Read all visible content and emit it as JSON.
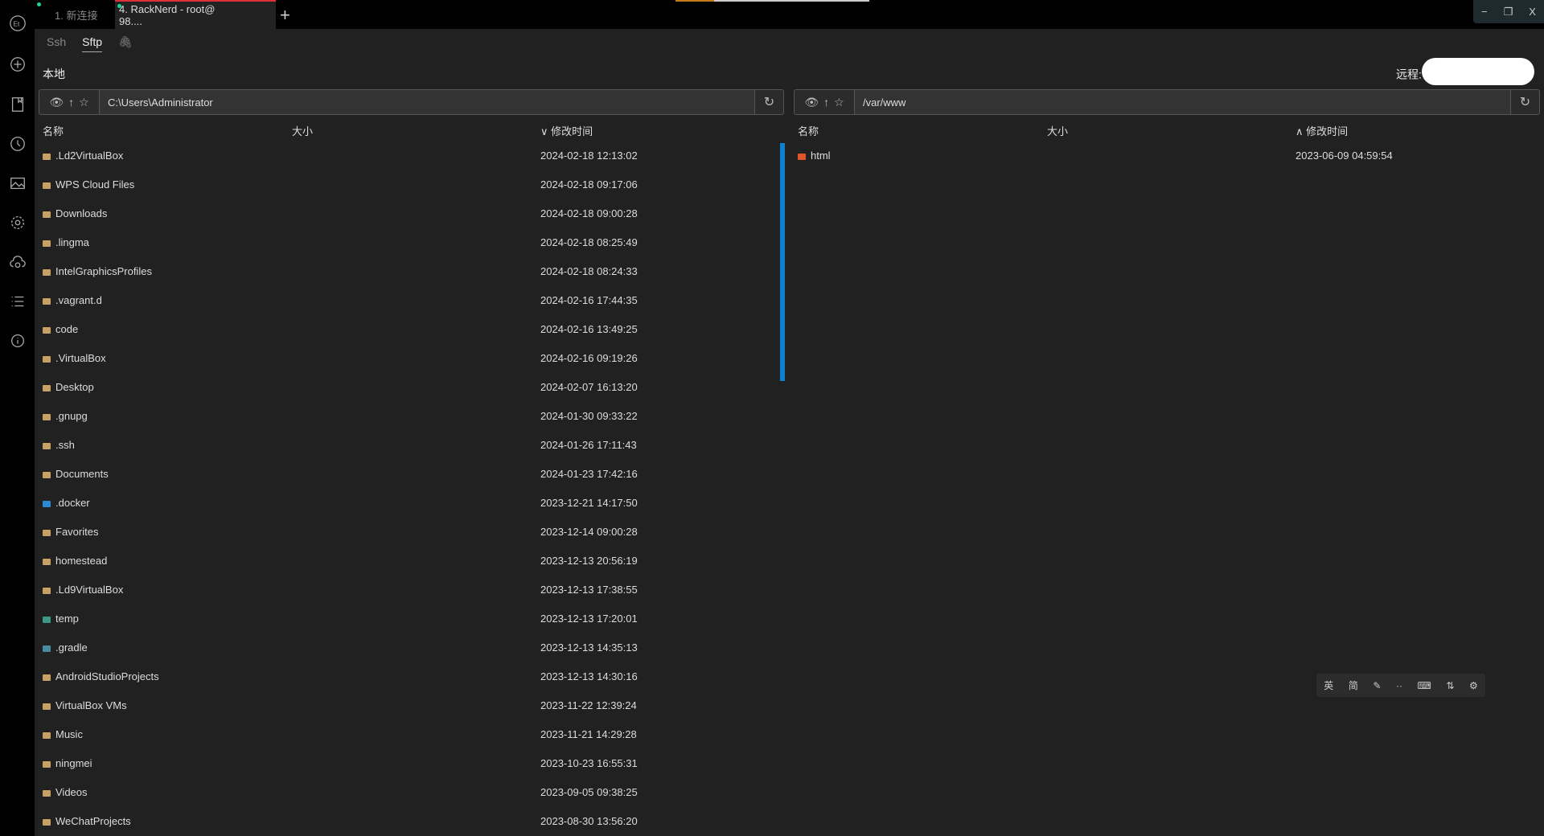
{
  "titlebar": {
    "tabs": [
      {
        "label": "1. 新连接"
      },
      {
        "label": "4. RackNerd - root@    98...."
      }
    ],
    "add_tab": "+",
    "progress_percent": 20,
    "window_controls": {
      "minimize": "−",
      "restore": "❐",
      "close": "X"
    }
  },
  "sidebar": {
    "icons": [
      "logo-icon",
      "add-icon",
      "bookmark-icon",
      "history-icon",
      "image-icon",
      "gear-icon",
      "cloud-sync-icon",
      "list-icon",
      "info-icon"
    ]
  },
  "subtabs": {
    "ssh": "Ssh",
    "sftp": "Sftp",
    "attach": "attach-icon"
  },
  "local": {
    "title": "本地",
    "path": "C:\\Users\\Administrator",
    "headers": {
      "name": "名称",
      "size": "大小",
      "mtime": "∨ 修改时间"
    },
    "files": [
      {
        "name": ".Ld2VirtualBox",
        "mtime": "2024-02-18 12:13:02",
        "icon": "folder"
      },
      {
        "name": "WPS Cloud Files",
        "mtime": "2024-02-18 09:17:06",
        "icon": "folder"
      },
      {
        "name": "Downloads",
        "mtime": "2024-02-18 09:00:28",
        "icon": "folder"
      },
      {
        "name": ".lingma",
        "mtime": "2024-02-18 08:25:49",
        "icon": "folder"
      },
      {
        "name": "IntelGraphicsProfiles",
        "mtime": "2024-02-18 08:24:33",
        "icon": "folder"
      },
      {
        "name": ".vagrant.d",
        "mtime": "2024-02-16 17:44:35",
        "icon": "folder"
      },
      {
        "name": "code",
        "mtime": "2024-02-16 13:49:25",
        "icon": "folder"
      },
      {
        "name": ".VirtualBox",
        "mtime": "2024-02-16 09:19:26",
        "icon": "folder"
      },
      {
        "name": "Desktop",
        "mtime": "2024-02-07 16:13:20",
        "icon": "folder"
      },
      {
        "name": ".gnupg",
        "mtime": "2024-01-30 09:33:22",
        "icon": "folder"
      },
      {
        "name": ".ssh",
        "mtime": "2024-01-26 17:11:43",
        "icon": "folder"
      },
      {
        "name": "Documents",
        "mtime": "2024-01-23 17:42:16",
        "icon": "folder"
      },
      {
        "name": ".docker",
        "mtime": "2023-12-21 14:17:50",
        "icon": "docker-folder"
      },
      {
        "name": "Favorites",
        "mtime": "2023-12-14 09:00:28",
        "icon": "folder"
      },
      {
        "name": "homestead",
        "mtime": "2023-12-13 20:56:19",
        "icon": "folder"
      },
      {
        "name": ".Ld9VirtualBox",
        "mtime": "2023-12-13 17:38:55",
        "icon": "folder"
      },
      {
        "name": "temp",
        "mtime": "2023-12-13 17:20:01",
        "icon": "temp-folder"
      },
      {
        "name": ".gradle",
        "mtime": "2023-12-13 14:35:13",
        "icon": "gradle-folder"
      },
      {
        "name": "AndroidStudioProjects",
        "mtime": "2023-12-13 14:30:16",
        "icon": "folder"
      },
      {
        "name": "VirtualBox VMs",
        "mtime": "2023-11-22 12:39:24",
        "icon": "folder"
      },
      {
        "name": "Music",
        "mtime": "2023-11-21 14:29:28",
        "icon": "folder"
      },
      {
        "name": "ningmei",
        "mtime": "2023-10-23 16:55:31",
        "icon": "folder"
      },
      {
        "name": "Videos",
        "mtime": "2023-09-05 09:38:25",
        "icon": "folder"
      },
      {
        "name": "WeChatProjects",
        "mtime": "2023-08-30 13:56:20",
        "icon": "folder"
      }
    ]
  },
  "remote": {
    "title": "远程:",
    "path": "/var/www",
    "headers": {
      "name": "名称",
      "size": "大小",
      "mtime": "∧ 修改时间"
    },
    "files": [
      {
        "name": "html",
        "mtime": "2023-06-09 04:59:54",
        "icon": "html-folder"
      }
    ]
  },
  "ime_toolbar": [
    "英",
    "简",
    "✎",
    "··",
    "⌨",
    "⇅",
    "⚙"
  ],
  "colors": {
    "folder": "#c8a165",
    "docker-folder": "#2a8ad6",
    "temp-folder": "#3a9a86",
    "gradle-folder": "#4a8aa0",
    "html-folder": "#e0562b",
    "scrollbar": "#0f7fcf",
    "accent": "#e0303a"
  }
}
